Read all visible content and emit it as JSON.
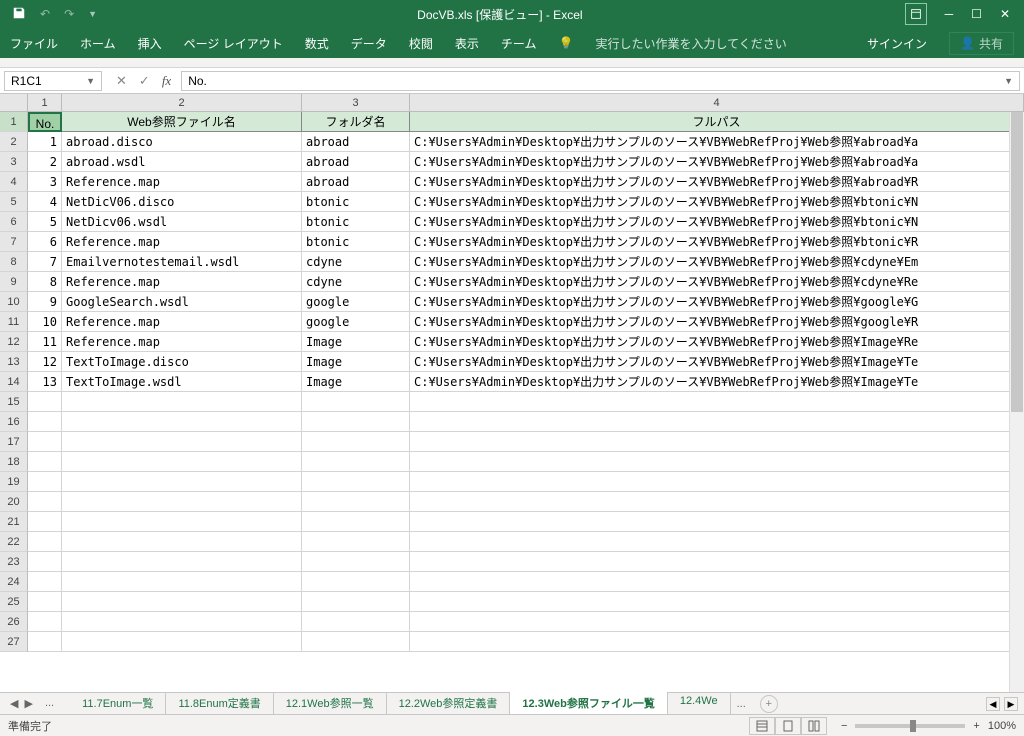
{
  "title": "DocVB.xls  [保護ビュー] - Excel",
  "ribbon": {
    "tabs": [
      "ファイル",
      "ホーム",
      "挿入",
      "ページ レイアウト",
      "数式",
      "データ",
      "校閲",
      "表示",
      "チーム"
    ],
    "tellme_placeholder": "実行したい作業を入力してください",
    "signin": "サインイン",
    "share": "共有"
  },
  "formula": {
    "name_box": "R1C1",
    "value": "No."
  },
  "columns": {
    "col_nums": [
      "1",
      "2",
      "3",
      "4"
    ],
    "headers": [
      "No.",
      "Web参照ファイル名",
      "フォルダ名",
      "フルパス"
    ]
  },
  "rows": [
    {
      "no": "1",
      "file": "abroad.disco",
      "folder": "abroad",
      "path": "C:¥Users¥Admin¥Desktop¥出力サンプルのソース¥VB¥WebRefProj¥Web参照¥abroad¥a"
    },
    {
      "no": "2",
      "file": "abroad.wsdl",
      "folder": "abroad",
      "path": "C:¥Users¥Admin¥Desktop¥出力サンプルのソース¥VB¥WebRefProj¥Web参照¥abroad¥a"
    },
    {
      "no": "3",
      "file": "Reference.map",
      "folder": "abroad",
      "path": "C:¥Users¥Admin¥Desktop¥出力サンプルのソース¥VB¥WebRefProj¥Web参照¥abroad¥R"
    },
    {
      "no": "4",
      "file": "NetDicV06.disco",
      "folder": "btonic",
      "path": "C:¥Users¥Admin¥Desktop¥出力サンプルのソース¥VB¥WebRefProj¥Web参照¥btonic¥N"
    },
    {
      "no": "5",
      "file": "NetDicv06.wsdl",
      "folder": "btonic",
      "path": "C:¥Users¥Admin¥Desktop¥出力サンプルのソース¥VB¥WebRefProj¥Web参照¥btonic¥N"
    },
    {
      "no": "6",
      "file": "Reference.map",
      "folder": "btonic",
      "path": "C:¥Users¥Admin¥Desktop¥出力サンプルのソース¥VB¥WebRefProj¥Web参照¥btonic¥R"
    },
    {
      "no": "7",
      "file": "Emailvernotestemail.wsdl",
      "folder": "cdyne",
      "path": "C:¥Users¥Admin¥Desktop¥出力サンプルのソース¥VB¥WebRefProj¥Web参照¥cdyne¥Em"
    },
    {
      "no": "8",
      "file": "Reference.map",
      "folder": "cdyne",
      "path": "C:¥Users¥Admin¥Desktop¥出力サンプルのソース¥VB¥WebRefProj¥Web参照¥cdyne¥Re"
    },
    {
      "no": "9",
      "file": "GoogleSearch.wsdl",
      "folder": "google",
      "path": "C:¥Users¥Admin¥Desktop¥出力サンプルのソース¥VB¥WebRefProj¥Web参照¥google¥G"
    },
    {
      "no": "10",
      "file": "Reference.map",
      "folder": "google",
      "path": "C:¥Users¥Admin¥Desktop¥出力サンプルのソース¥VB¥WebRefProj¥Web参照¥google¥R"
    },
    {
      "no": "11",
      "file": "Reference.map",
      "folder": "Image",
      "path": "C:¥Users¥Admin¥Desktop¥出力サンプルのソース¥VB¥WebRefProj¥Web参照¥Image¥Re"
    },
    {
      "no": "12",
      "file": "TextToImage.disco",
      "folder": "Image",
      "path": "C:¥Users¥Admin¥Desktop¥出力サンプルのソース¥VB¥WebRefProj¥Web参照¥Image¥Te"
    },
    {
      "no": "13",
      "file": "TextToImage.wsdl",
      "folder": "Image",
      "path": "C:¥Users¥Admin¥Desktop¥出力サンプルのソース¥VB¥WebRefProj¥Web参照¥Image¥Te"
    }
  ],
  "empty_row_start": 15,
  "empty_row_end": 27,
  "sheets": {
    "tabs": [
      "11.7Enum一覧",
      "11.8Enum定義書",
      "12.1Web参照一覧",
      "12.2Web参照定義書",
      "12.3Web参照ファイル一覧",
      "12.4We"
    ],
    "active_index": 4
  },
  "status": {
    "ready": "準備完了",
    "zoom": "100%"
  }
}
